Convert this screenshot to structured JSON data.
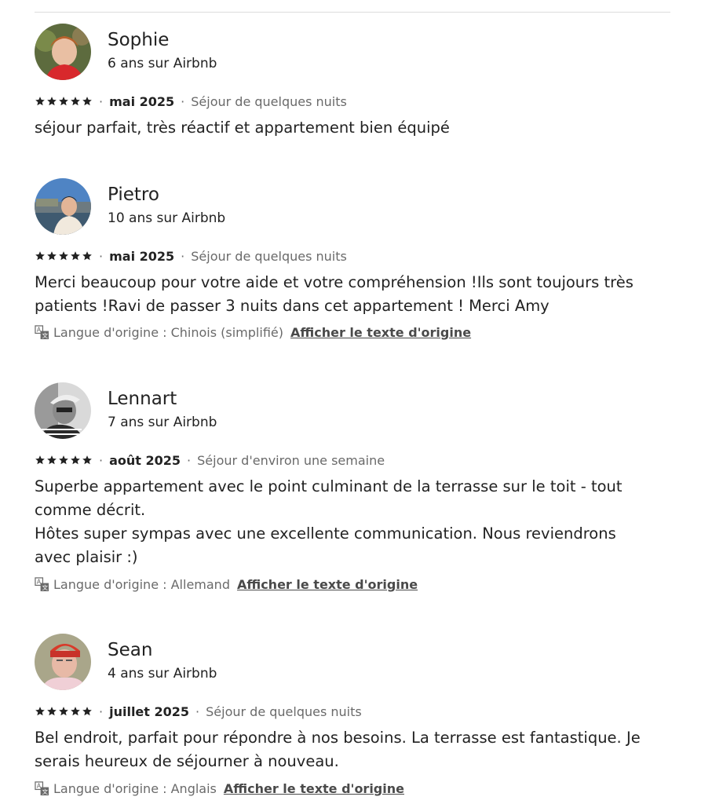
{
  "reviews": [
    {
      "name": "Sophie",
      "tenure": "6 ans sur Airbnb",
      "rating": 5,
      "date": "mai 2025",
      "stay": "Séjour de quelques nuits",
      "text": [
        "séjour parfait, très réactif et appartement bien équipé"
      ],
      "language_note": null,
      "show_original": null
    },
    {
      "name": "Pietro",
      "tenure": "10 ans sur Airbnb",
      "rating": 5,
      "date": "mai 2025",
      "stay": "Séjour de quelques nuits",
      "text": [
        "Merci beaucoup pour votre aide et votre compréhension !Ils sont toujours très patients !Ravi de passer 3 nuits dans cet appartement ! Merci Amy"
      ],
      "language_note": "Langue d'origine : Chinois (simplifié)",
      "show_original": "Afficher le texte d'origine"
    },
    {
      "name": "Lennart",
      "tenure": "7 ans sur Airbnb",
      "rating": 5,
      "date": "août 2025",
      "stay": "Séjour d'environ une semaine",
      "text": [
        "Superbe appartement avec le point culminant de la terrasse sur le toit - tout comme décrit.",
        "Hôtes super sympas avec une excellente communication. Nous reviendrons avec plaisir :)"
      ],
      "language_note": "Langue d'origine : Allemand",
      "show_original": "Afficher le texte d'origine"
    },
    {
      "name": "Sean",
      "tenure": "4 ans sur Airbnb",
      "rating": 5,
      "date": "juillet 2025",
      "stay": "Séjour de quelques nuits",
      "text": [
        "Bel endroit, parfait pour répondre à nos besoins. La terrasse est fantastique. Je serais heureux de séjourner à nouveau."
      ],
      "language_note": "Langue d'origine : Anglais",
      "show_original": "Afficher le texte d'origine"
    }
  ],
  "separator": "·",
  "icons": {
    "star": "star-icon",
    "translate": "translate-icon"
  },
  "colors": {
    "text": "#222222",
    "muted": "#6a6a6a",
    "divider": "#dddddd"
  }
}
